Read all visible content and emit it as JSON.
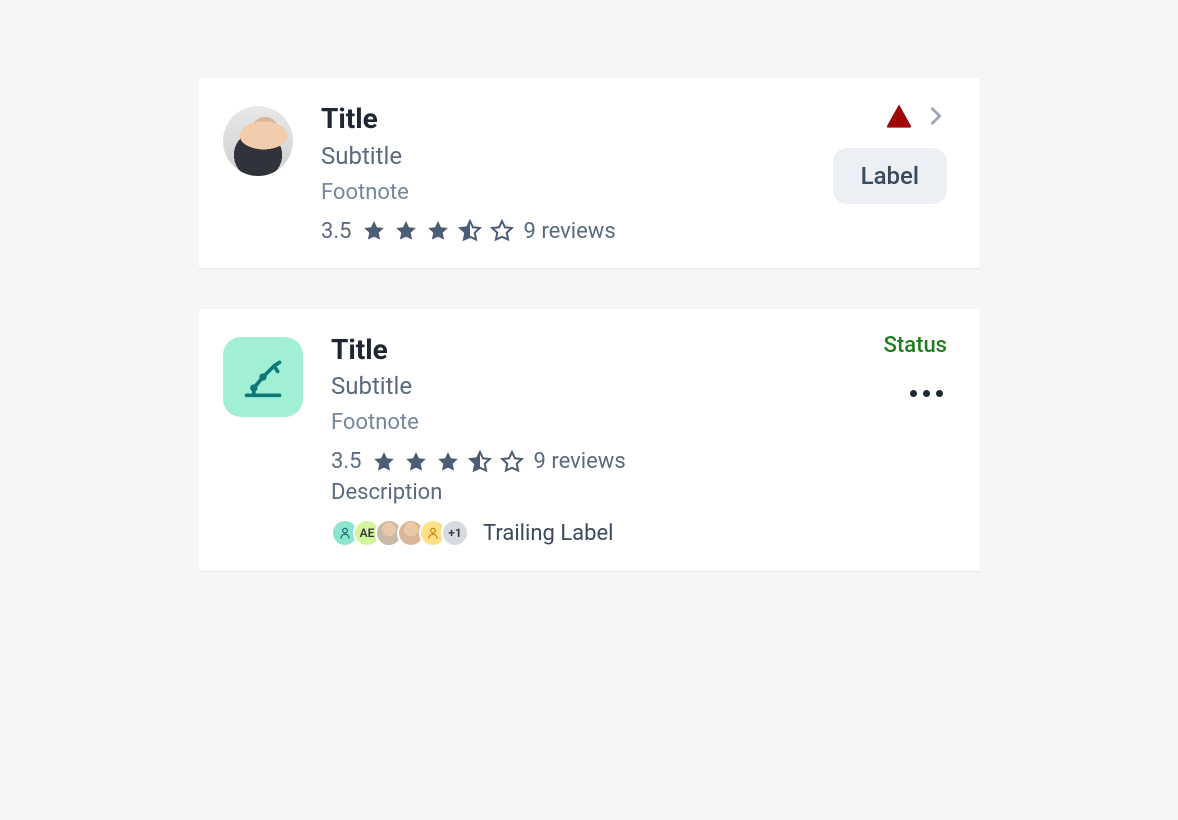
{
  "colors": {
    "warning": "#a00808",
    "status_positive": "#1f7d1f",
    "star_fill": "#4b5c74",
    "icon_bg": "#a1f0d6",
    "icon_stroke": "#0e7878"
  },
  "cards": [
    {
      "icon": "avatar-photo",
      "title": "Title",
      "subtitle": "Subtitle",
      "footnote": "Footnote",
      "rating_value": "3.5",
      "review_count": "9 reviews",
      "right": {
        "warning_icon": "warning-triangle",
        "disclosure": "chevron-right",
        "pill_label": "Label"
      }
    },
    {
      "icon": "robot-arm",
      "title": "Title",
      "subtitle": "Subtitle",
      "footnote": "Footnote",
      "rating_value": "3.5",
      "review_count": "9 reviews",
      "description": "Description",
      "chips": {
        "items": [
          {
            "kind": "icon-person",
            "bg": "#8de4cf"
          },
          {
            "kind": "initials",
            "text": "AE",
            "bg": "#d5f59a"
          },
          {
            "kind": "photo",
            "bg": "#c8b9a6"
          },
          {
            "kind": "photo",
            "bg": "#d9b699"
          },
          {
            "kind": "icon-person",
            "bg": "#ffe18a",
            "stroke": "#d67b00"
          },
          {
            "kind": "overflow",
            "text": "+1",
            "bg": "#d6dbe1"
          }
        ],
        "trailing_label": "Trailing Label"
      },
      "right": {
        "status_text": "Status",
        "more_icon": "more-horizontal"
      }
    }
  ]
}
